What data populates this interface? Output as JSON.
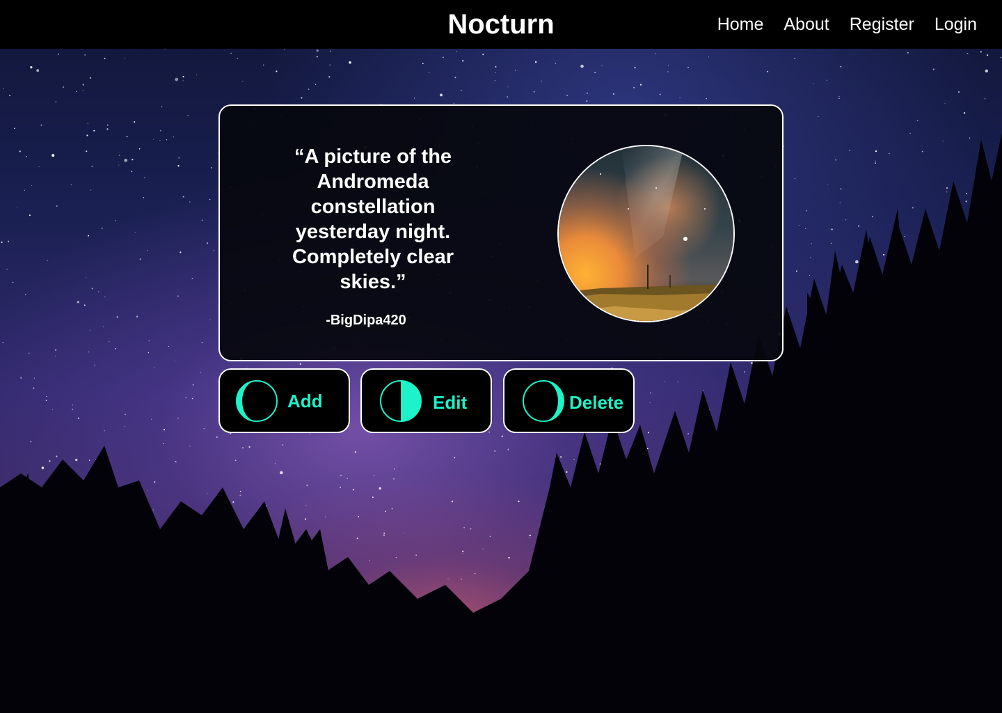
{
  "app": {
    "title": "Nocturn"
  },
  "nav": {
    "items": [
      {
        "label": "Home"
      },
      {
        "label": "About"
      },
      {
        "label": "Register"
      },
      {
        "label": "Login"
      }
    ]
  },
  "post": {
    "quote": "“A picture of the Andromeda constellation yesterday night. Completely clear skies.”",
    "author": "-BigDipa420"
  },
  "actions": [
    {
      "label": "Add",
      "icon": "crescent-moon-icon"
    },
    {
      "label": "Edit",
      "icon": "half-moon-icon"
    },
    {
      "label": "Delete",
      "icon": "gibbous-moon-icon"
    }
  ],
  "colors": {
    "accent": "#1df2c8",
    "header_bg": "#000000",
    "card_bg": "#06080e",
    "border": "#ffffff"
  }
}
